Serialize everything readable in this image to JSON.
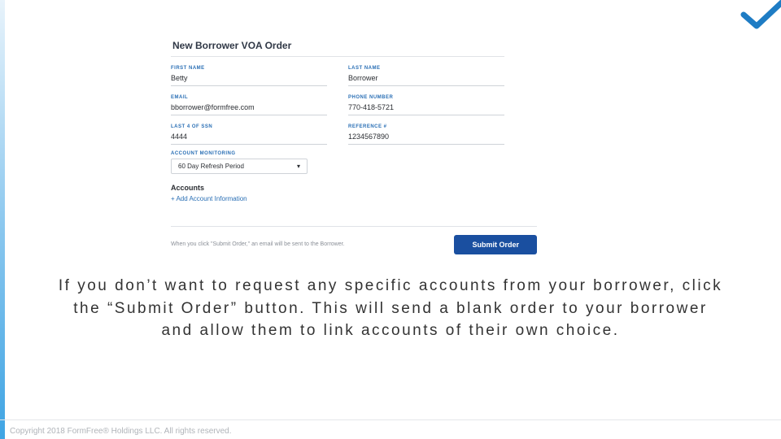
{
  "logo": {
    "name": "checkmark"
  },
  "form": {
    "title": "New Borrower VOA Order",
    "first_name": {
      "label": "FIRST NAME",
      "value": "Betty"
    },
    "last_name": {
      "label": "LAST NAME",
      "value": "Borrower"
    },
    "email": {
      "label": "EMAIL",
      "value": "bborrower@formfree.com"
    },
    "phone": {
      "label": "PHONE NUMBER",
      "value": "770-418-5721"
    },
    "ssn": {
      "label": "LAST 4 OF SSN",
      "value": "4444"
    },
    "reference": {
      "label": "REFERENCE #",
      "value": "1234567890"
    },
    "monitoring": {
      "label": "ACCOUNT MONITORING",
      "value": "60 Day Refresh Period"
    },
    "accounts_heading": "Accounts",
    "add_account_link": "+ Add Account Information"
  },
  "submit": {
    "note": "When you click \"Submit Order,\" an email will be sent to the Borrower.",
    "button": "Submit Order"
  },
  "instruction": "If you don’t want to request any specific accounts from your borrower, click the “Submit Order” button. This will send a blank order to your borrower and allow them to link accounts of their own choice.",
  "footer": {
    "copyright": "Copyright 2018 FormFree® Holdings LLC. All rights reserved."
  }
}
